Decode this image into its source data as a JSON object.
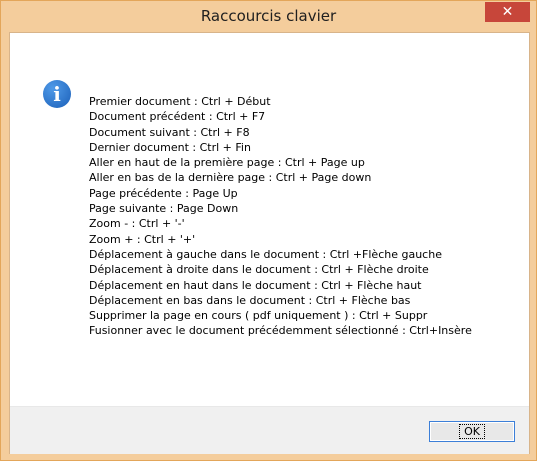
{
  "window": {
    "title": "Raccourcis clavier",
    "close_glyph": "✕"
  },
  "dialog": {
    "icon": "information-icon",
    "icon_glyph": "i",
    "lines": [
      "Premier document : Ctrl + Début",
      "Document précédent : Ctrl + F7",
      "Document suivant : Ctrl + F8",
      "Dernier document : Ctrl + Fin",
      "Aller en haut de la première page : Ctrl + Page up",
      "Aller en bas de la dernière page : Ctrl + Page down",
      "Page précédente : Page Up",
      "Page suivante : Page Down",
      "Zoom - : Ctrl + '-'",
      "Zoom + : Ctrl + '+'",
      "Déplacement à gauche dans le document : Ctrl +Flèche gauche",
      "Déplacement à droite dans le document : Ctrl + Flèche droite",
      "Déplacement en haut  dans le document : Ctrl + Flèche haut",
      "Déplacement en bas dans le document : Ctrl + Flèche bas",
      "Supprimer la page en cours ( pdf uniquement ) : Ctrl + Suppr",
      "Fusionner avec le document précédemment sélectionné : Ctrl+Insère"
    ],
    "ok_label": "OK"
  },
  "colors": {
    "titlebar": "#f4cd9c",
    "close_button": "#c7463a",
    "footer": "#f0f0f0",
    "info_icon": "#1b6ec2"
  }
}
